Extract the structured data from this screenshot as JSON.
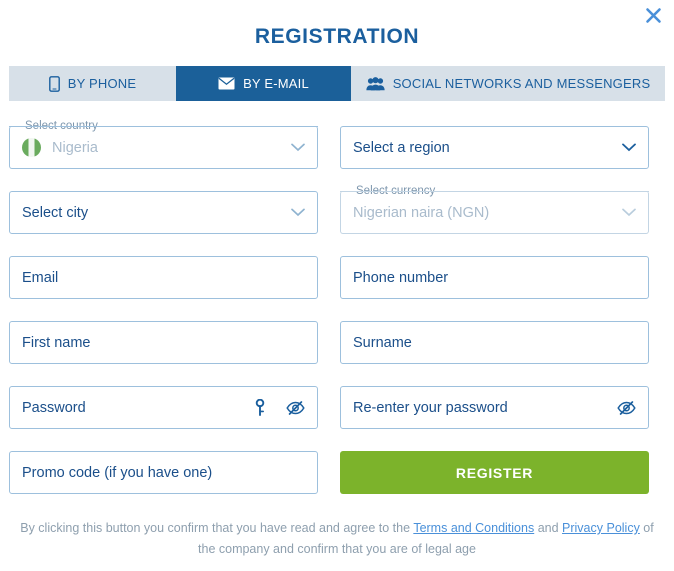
{
  "dialog": {
    "title": "REGISTRATION",
    "close_icon": "close-icon"
  },
  "tabs": [
    {
      "label": "BY PHONE",
      "icon": "phone-icon",
      "active": false
    },
    {
      "label": "BY E-MAIL",
      "icon": "envelope-icon",
      "active": true
    },
    {
      "label": "SOCIAL NETWORKS AND MESSENGERS",
      "icon": "people-group-icon",
      "active": false
    }
  ],
  "fields": {
    "country": {
      "label": "Select country",
      "value": "Nigeria",
      "flag": "nigeria-flag-icon",
      "state": "filled"
    },
    "region": {
      "placeholder": "Select a region",
      "value": "",
      "state": "empty"
    },
    "city": {
      "placeholder": "Select city",
      "value": "",
      "state": "empty"
    },
    "currency": {
      "label": "Select currency",
      "value": "Nigerian naira (NGN)",
      "state": "disabled"
    },
    "email": {
      "placeholder": "Email",
      "value": ""
    },
    "phone": {
      "placeholder": "Phone number",
      "value": ""
    },
    "first_name": {
      "placeholder": "First name",
      "value": ""
    },
    "surname": {
      "placeholder": "Surname",
      "value": ""
    },
    "password": {
      "placeholder": "Password",
      "value": "",
      "icons": [
        "key-icon",
        "eye-slash-icon"
      ]
    },
    "password_confirm": {
      "placeholder": "Re-enter your password",
      "value": "",
      "icons": [
        "eye-slash-icon"
      ]
    },
    "promo_code": {
      "placeholder": "Promo code (if you have one)",
      "value": ""
    }
  },
  "actions": {
    "register_label": "REGISTER"
  },
  "footer": {
    "text_before": "By clicking this button you confirm that you have read and agree to the ",
    "terms_link": "Terms and Conditions",
    "text_middle": " and ",
    "privacy_link": "Privacy Policy",
    "text_after": " of the company and confirm that you are of legal age"
  },
  "colors": {
    "accent_blue": "#1b5f9e",
    "tab_active": "#1b6099",
    "tab_bar_bg": "#d7e0e8",
    "register_green": "#7cb32b",
    "border": "#9dc0dd",
    "link": "#4a90d9",
    "muted_text": "#8e9fae"
  }
}
